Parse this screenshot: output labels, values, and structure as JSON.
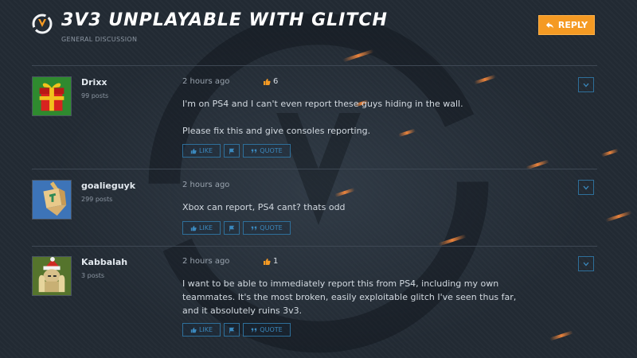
{
  "header": {
    "title": "3V3 UNPLAYABLE WITH GLITCH",
    "subtitle": "GENERAL DISCUSSION",
    "reply_label": "REPLY"
  },
  "actions": {
    "like_label": "LIKE",
    "quote_label": "QUOTE"
  },
  "posts": [
    {
      "author": "Drixx",
      "post_count": "99 posts",
      "time": "2 hours ago",
      "likes": "6",
      "avatar_icon": "gift-icon",
      "paragraphs": [
        "I'm on PS4 and I can't even report these guys hiding in the wall.",
        "Please fix this and give consoles reporting."
      ]
    },
    {
      "author": "goalieguyk",
      "post_count": "299 posts",
      "time": "2 hours ago",
      "likes": "",
      "avatar_icon": "dreidel-icon",
      "paragraphs": [
        "Xbox can report, PS4 cant? thats odd"
      ]
    },
    {
      "author": "Kabbalah",
      "post_count": "3 posts",
      "time": "2 hours ago",
      "likes": "1",
      "avatar_icon": "santa-character-icon",
      "paragraphs": [
        "I want to be able to immediately report this from PS4, including my own teammates. It's the most broken, easily exploitable glitch I've seen thus far, and it absolutely ruins 3v3."
      ]
    }
  ],
  "colors": {
    "accent_orange": "#f59a23",
    "link_blue": "#3b88bd",
    "background": "#222a33"
  }
}
